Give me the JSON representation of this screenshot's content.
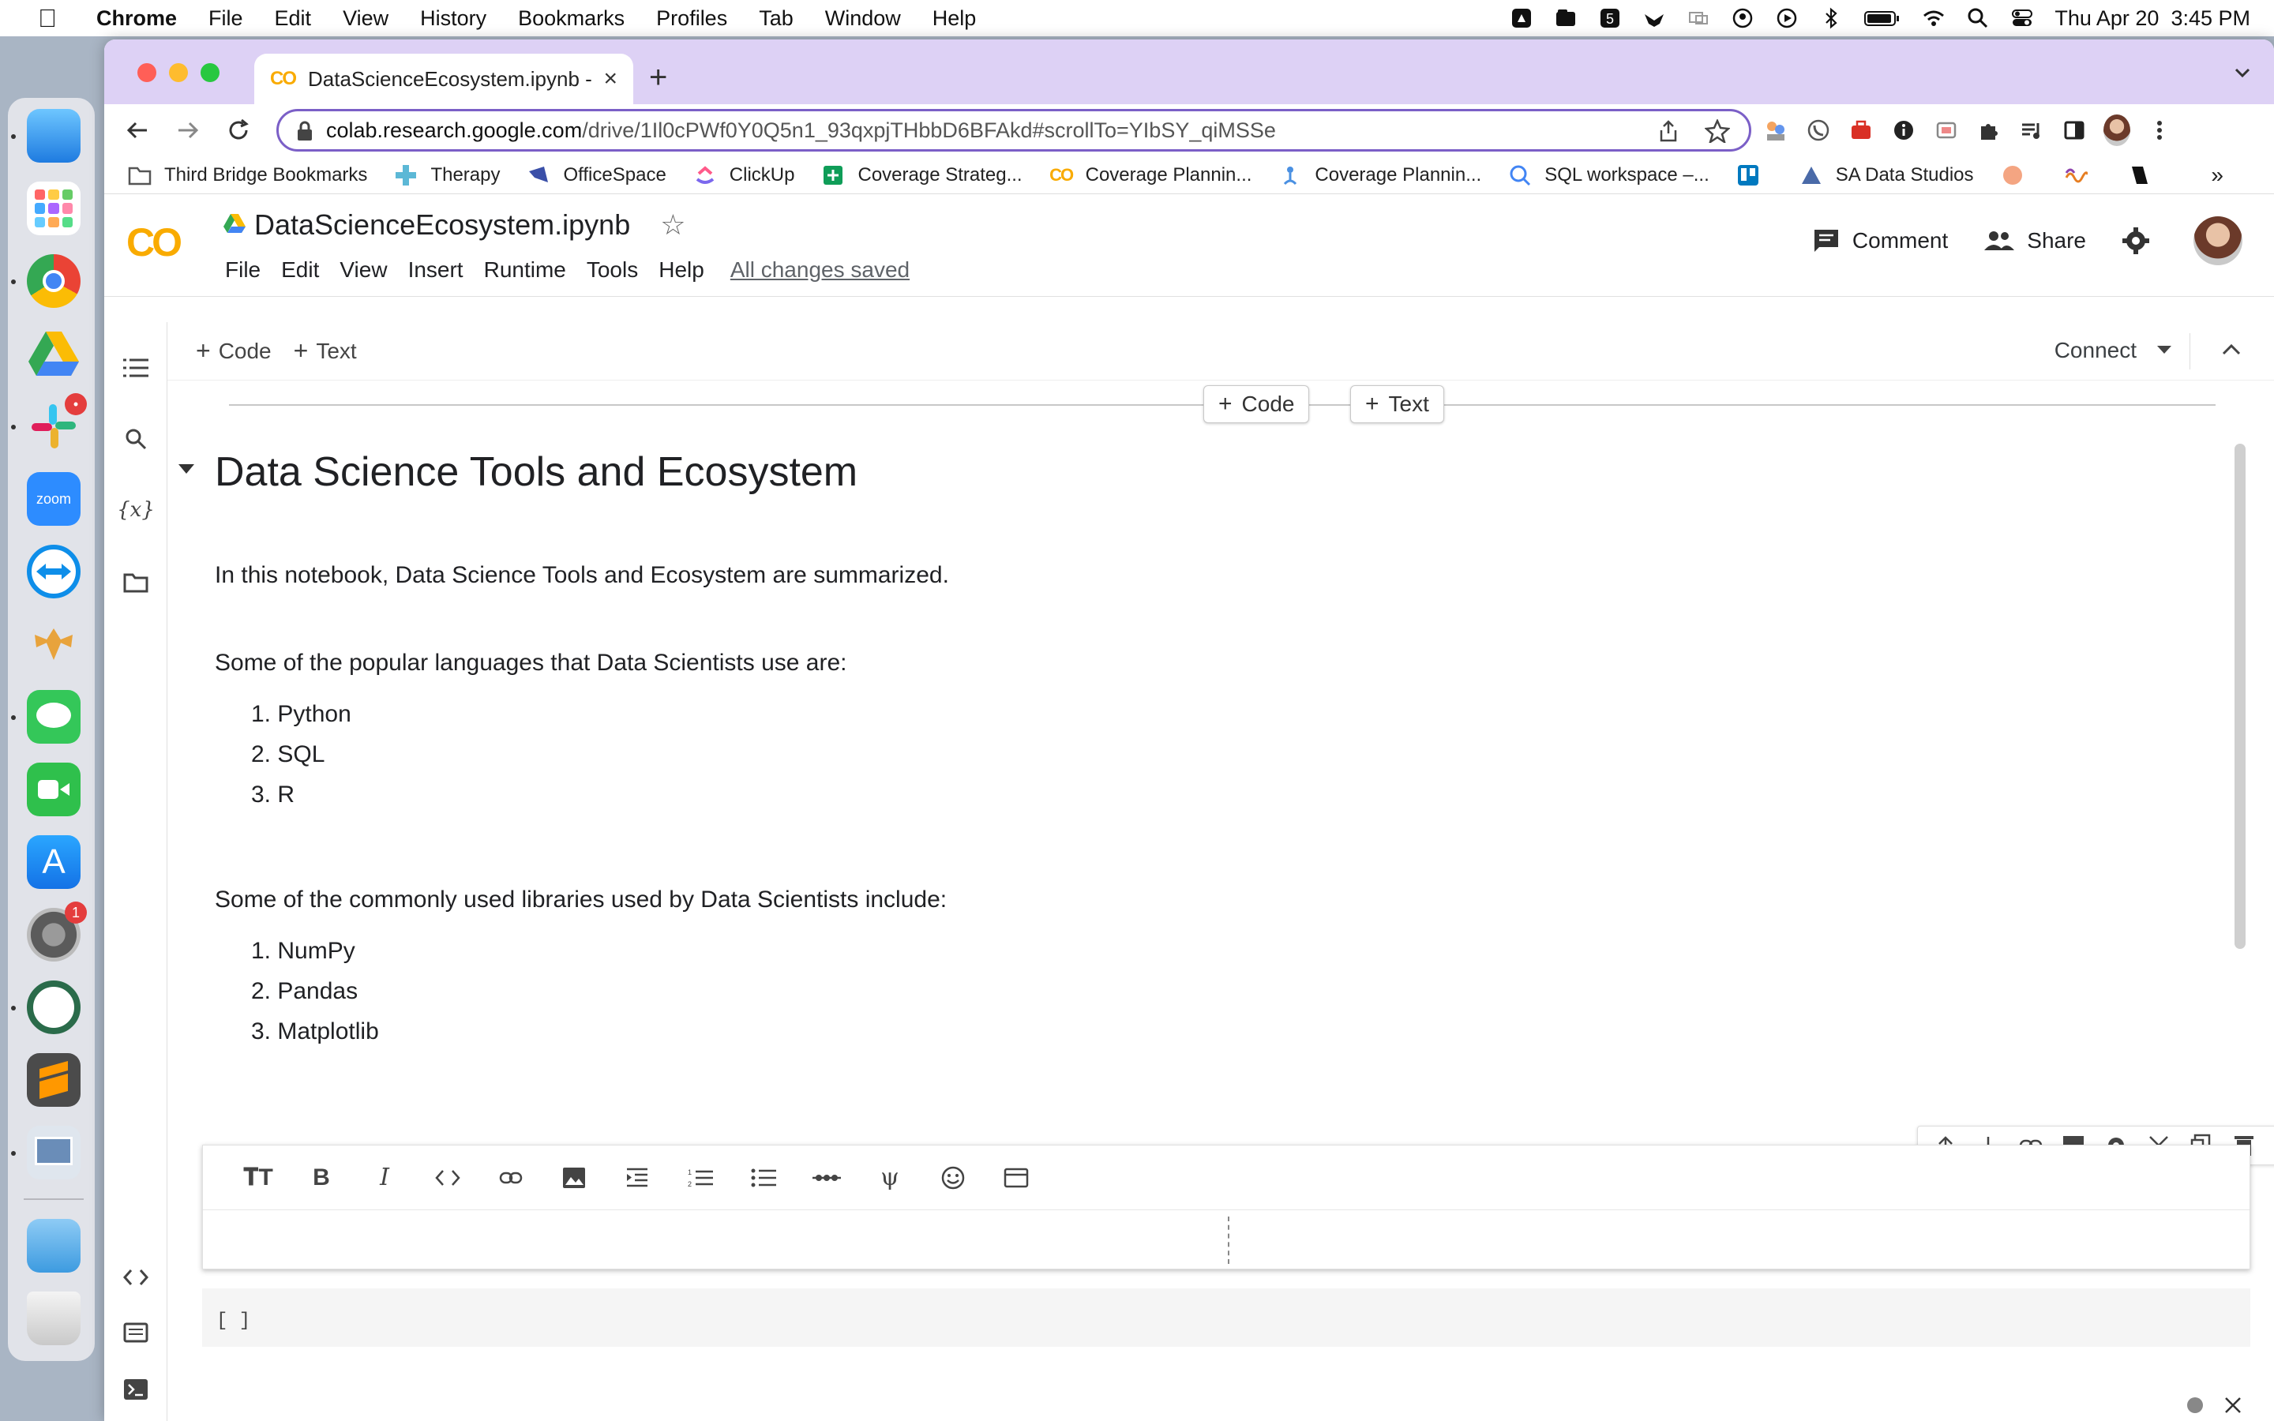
{
  "menubar": {
    "app": "Chrome",
    "items": [
      "File",
      "Edit",
      "View",
      "History",
      "Bookmarks",
      "Profiles",
      "Tab",
      "Window",
      "Help"
    ],
    "clock": "Thu Apr 20  3:45 PM"
  },
  "browser": {
    "tab_title": "DataScienceEcosystem.ipynb - ",
    "url_host": "colab.research.google.com",
    "url_path": "/drive/1Il0cPWf0Y0Q5n1_93qxpjTHbbD6BFAkd#scrollTo=YIbSY_qiMSSe",
    "bookmarks": [
      {
        "label": "Third Bridge Bookmarks",
        "icon": "folder-icon"
      },
      {
        "label": "Therapy",
        "icon": "therapy-icon"
      },
      {
        "label": "OfficeSpace",
        "icon": "officespace-icon"
      },
      {
        "label": "ClickUp",
        "icon": "clickup-icon"
      },
      {
        "label": "Coverage Strateg...",
        "icon": "sheets-icon"
      },
      {
        "label": "Coverage Plannin...",
        "icon": "colab-icon"
      },
      {
        "label": "Coverage Plannin...",
        "icon": "figure-icon"
      },
      {
        "label": "SQL workspace –...",
        "icon": "sql-icon"
      },
      {
        "label": "",
        "icon": "trello-icon"
      },
      {
        "label": "SA Data Studios",
        "icon": "datastudio-icon"
      }
    ],
    "more_bookmarks": "»"
  },
  "colab": {
    "logo": "CO",
    "notebook_name": "DataScienceEcosystem.ipynb",
    "menu": [
      "File",
      "Edit",
      "View",
      "Insert",
      "Runtime",
      "Tools",
      "Help"
    ],
    "save_status": "All changes saved",
    "comment_label": "Comment",
    "share_label": "Share",
    "add_code_label": "Code",
    "add_text_label": "Text",
    "connect_label": "Connect"
  },
  "notebook": {
    "heading": "Data Science Tools and Ecosystem",
    "intro": "In this notebook, Data Science Tools and Ecosystem are summarized.",
    "languages_intro": "Some of the popular languages that Data Scientists use are:",
    "languages": [
      "1. Python",
      "2. SQL",
      "3. R"
    ],
    "libraries_intro": "Some of the commonly used libraries used by Data Scientists include:",
    "libraries": [
      "1. NumPy",
      "2. Pandas",
      "3. Matplotlib"
    ],
    "code_cell_prompt": "[ ]"
  },
  "colors": {
    "titlebar": "#ddd1f5",
    "omnibox_border": "#7b5fc7",
    "colab_orange": "#f9ab00"
  }
}
